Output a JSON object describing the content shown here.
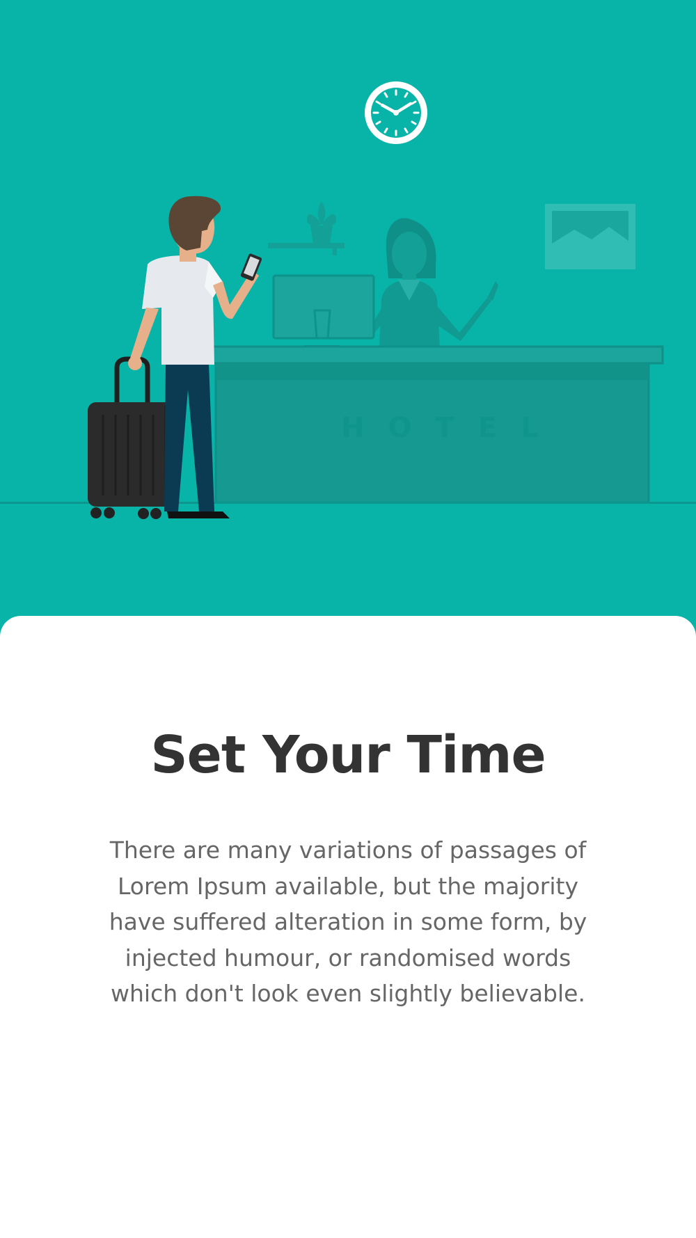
{
  "theme": {
    "accent": "#08B3A8",
    "card_background": "#FFFFFF",
    "title_color": "#333333",
    "body_color": "#666666"
  },
  "illustration": {
    "desk_sign": "HOTEL",
    "icons": [
      "clock-icon",
      "plant-icon",
      "picture-frame-icon",
      "computer-monitor-icon",
      "phone-icon",
      "suitcase-icon"
    ]
  },
  "onboarding": {
    "title": "Set Your Time",
    "description": "There are many variations of passages of Lorem Ipsum available, but the majority have suffered alteration in some form, by injected humour, or randomised words which don't look even slightly believable."
  }
}
